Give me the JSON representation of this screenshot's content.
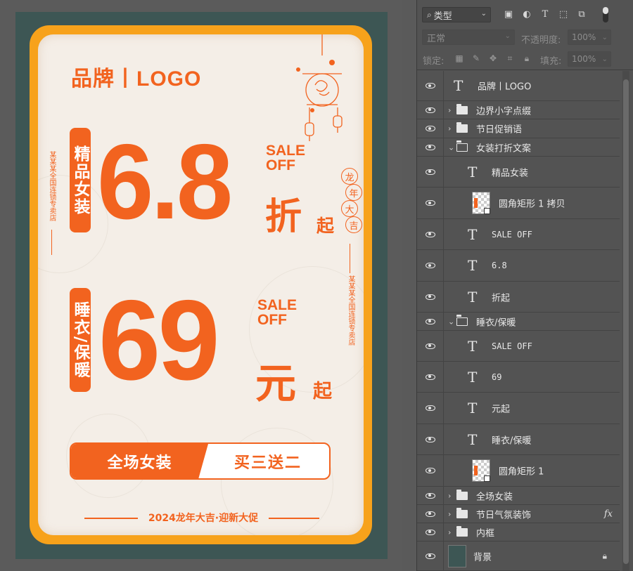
{
  "poster": {
    "brand": "品牌丨LOGO",
    "top_pill": "精品女装",
    "top_number": "6.8",
    "top_sale": "SALE OFF",
    "top_unit_big": "折",
    "top_unit_small": "起",
    "bottom_pill": "睡衣/保暖",
    "bottom_number": "69",
    "bottom_sale": "SALE OFF",
    "bottom_unit_big": "元",
    "bottom_unit_small": "起",
    "side_text_left": "某某某全国连锁专卖店",
    "side_text_right": "某某某全国连锁专卖店",
    "seal_chars": [
      "龙",
      "年",
      "大",
      "吉"
    ],
    "cta_left": "全场女装",
    "cta_right": "买三送二",
    "footer": "2024龙年大吉·迎新大促",
    "colors": {
      "accent": "#f2631f",
      "frame": "#f7a21b",
      "artboard_bg": "#3d5654",
      "paper": "#f4eee7"
    }
  },
  "panel": {
    "filter_label": "类型",
    "blend_mode": "正常",
    "opacity_label": "不透明度:",
    "opacity_value": "100%",
    "lock_label": "锁定:",
    "fill_label": "填充:",
    "fill_value": "100%",
    "layers": [
      {
        "type": "text",
        "name": "品牌丨LOGO",
        "indent": 0
      },
      {
        "type": "group",
        "name": "边界小字点缀",
        "indent": 0,
        "open": false
      },
      {
        "type": "group",
        "name": "节日促销语",
        "indent": 0,
        "open": false
      },
      {
        "type": "group",
        "name": "女装打折文案",
        "indent": 0,
        "open": true
      },
      {
        "type": "text",
        "name": "精品女装",
        "indent": 1
      },
      {
        "type": "shape",
        "name": "圆角矩形 1 拷贝",
        "indent": 1
      },
      {
        "type": "text",
        "name": "SALE OFF",
        "indent": 1
      },
      {
        "type": "text",
        "name": "6.8",
        "indent": 1
      },
      {
        "type": "text",
        "name": "折起",
        "indent": 1
      },
      {
        "type": "group",
        "name": "睡衣/保暖",
        "indent": 0,
        "open": true
      },
      {
        "type": "text",
        "name": "SALE OFF",
        "indent": 1
      },
      {
        "type": "text",
        "name": "69",
        "indent": 1
      },
      {
        "type": "text",
        "name": "元起",
        "indent": 1
      },
      {
        "type": "text",
        "name": "睡衣/保暖",
        "indent": 1
      },
      {
        "type": "shape",
        "name": "圆角矩形 1",
        "indent": 1
      },
      {
        "type": "group",
        "name": "全场女装",
        "indent": 0,
        "open": false
      },
      {
        "type": "group",
        "name": "节日气氛装饰",
        "indent": 0,
        "open": false,
        "fx": "fx"
      },
      {
        "type": "group",
        "name": "内框",
        "indent": 0,
        "open": false
      },
      {
        "type": "background",
        "name": "背景",
        "indent": 0,
        "locked": true
      }
    ]
  }
}
